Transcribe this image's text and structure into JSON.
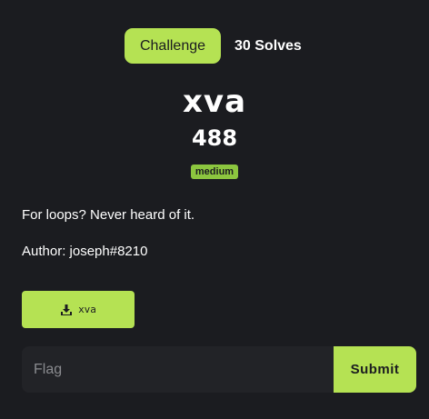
{
  "tabs": [
    {
      "label": "Challenge",
      "active": true
    },
    {
      "label": "30 Solves",
      "active": false
    }
  ],
  "challenge": {
    "name": "xva",
    "points": "488",
    "difficulty": "medium",
    "description": "For loops? Never heard of it.",
    "author": "Author: joseph#8210"
  },
  "download": {
    "label": "xva",
    "icon": "download-icon"
  },
  "flag_form": {
    "placeholder": "Flag",
    "value": "",
    "submit_label": "Submit"
  },
  "colors": {
    "accent": "#b5e253",
    "badge": "#8cc63f",
    "background": "#1b1c20",
    "input_bg": "#222327"
  }
}
